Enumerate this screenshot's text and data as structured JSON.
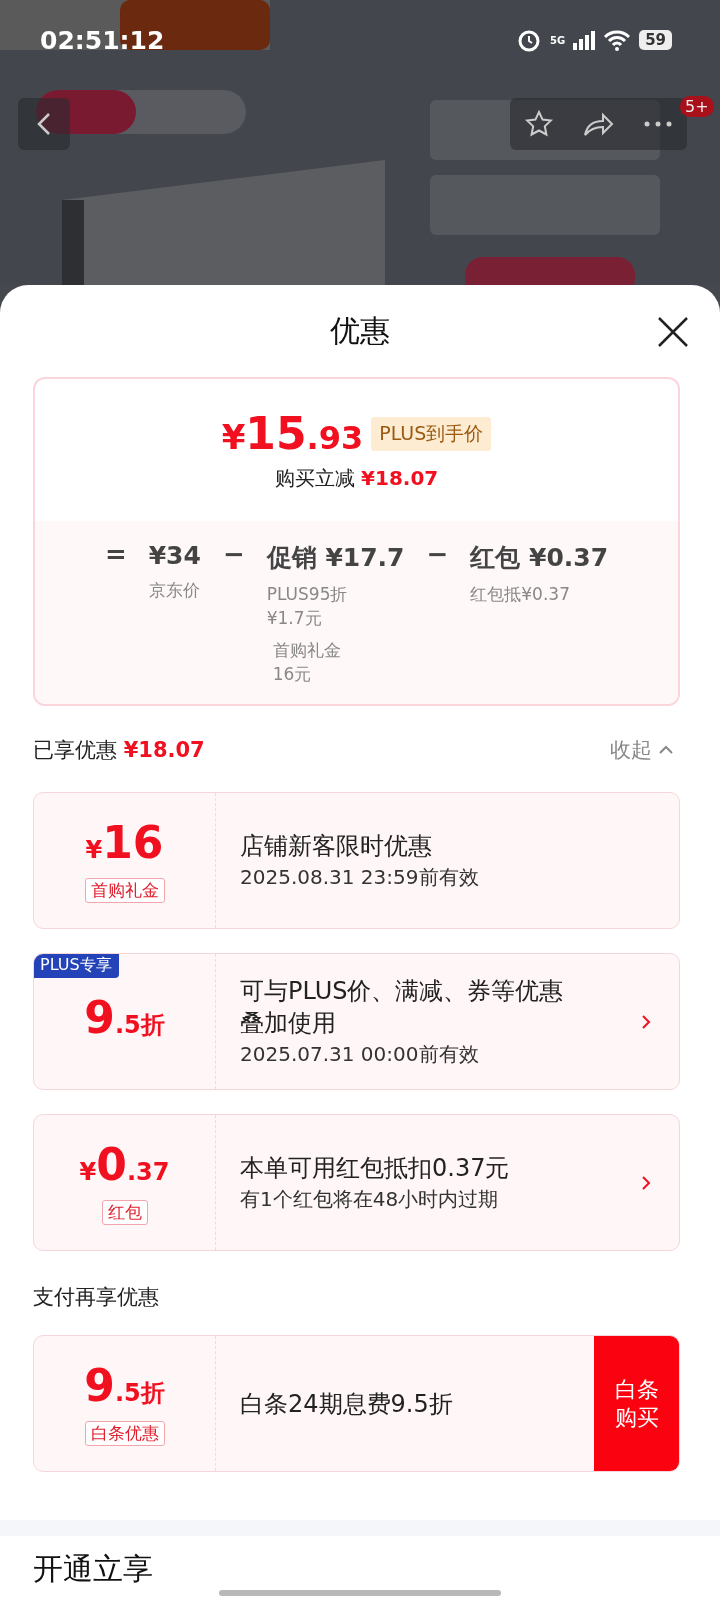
{
  "status_bar": {
    "time": "02:51:12",
    "battery": "59",
    "network": "5G"
  },
  "nav": {
    "badge": "5+"
  },
  "sheet": {
    "title": "优惠"
  },
  "summary": {
    "price_currency": "¥",
    "price_main": "15",
    "price_fraction": ".93",
    "price_tag": "PLUS到手价",
    "saving_label": "购买立减",
    "saving_value": "¥18.07",
    "breakdown": [
      {
        "operator": "=",
        "value": "¥34",
        "notes": [
          {
            "lines": [
              "京东价"
            ]
          }
        ]
      },
      {
        "operator": "−",
        "value": "促销 ¥17.7",
        "notes": [
          {
            "lines": [
              "PLUS95折",
              "¥1.7元"
            ]
          },
          {
            "lines": [
              "首购礼金",
              "16元"
            ]
          }
        ]
      },
      {
        "operator": "−",
        "value": "红包 ¥0.37",
        "notes": [
          {
            "lines": [
              "红包抵¥0.37"
            ]
          }
        ]
      }
    ]
  },
  "enjoyed": {
    "label": "已享优惠",
    "value": "¥18.07",
    "toggle": "收起",
    "expanded": true
  },
  "coupons": [
    {
      "currency": "¥",
      "main": "16",
      "tag": "首购礼金",
      "title": "店铺新客限时优惠",
      "subtitle": "2025.08.31 23:59前有效",
      "has_arrow": false
    },
    {
      "badge": "PLUS专享",
      "main": "9",
      "fraction": ".5折",
      "title": "可与PLUS价、满减、券等优惠叠加使用",
      "subtitle": "2025.07.31 00:00前有效",
      "has_arrow": true
    },
    {
      "currency": "¥",
      "main": "0",
      "fraction": ".37",
      "tag": "红包",
      "title": "本单可用红包抵扣0.37元",
      "subtitle": "有1个红包将在48小时内过期",
      "has_arrow": true
    }
  ],
  "pay_section": {
    "label": "支付再享优惠",
    "coupons": [
      {
        "main": "9",
        "fraction": ".5折",
        "tag": "白条优惠",
        "title": "白条24期息费9.5折",
        "button": "白条购买",
        "has_arrow": false
      }
    ]
  },
  "bottom_section": {
    "title": "开通立享"
  }
}
